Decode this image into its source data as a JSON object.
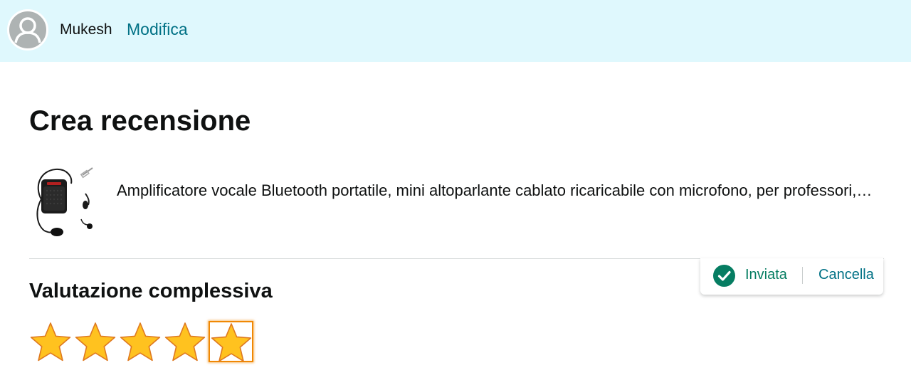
{
  "header": {
    "username": "Mukesh",
    "edit_label": "Modifica",
    "avatar_icon": "user-avatar-icon"
  },
  "page": {
    "title": "Crea recensione"
  },
  "product": {
    "title": "Amplificatore vocale Bluetooth portatile, mini altoparlante cablato ricaricabile con microfono, per professori, guide turistiche, istruttori, riunioni"
  },
  "status": {
    "label": "Inviata",
    "cancel_label": "Cancella",
    "icon": "check-circle-icon",
    "color": "#067d62"
  },
  "rating": {
    "section_title": "Valutazione complessiva",
    "value": 5,
    "max": 5,
    "star_color": "#ffc21f"
  },
  "colors": {
    "header_bg": "#dff8fd",
    "link": "#007185",
    "focus_ring": "#f08804"
  }
}
